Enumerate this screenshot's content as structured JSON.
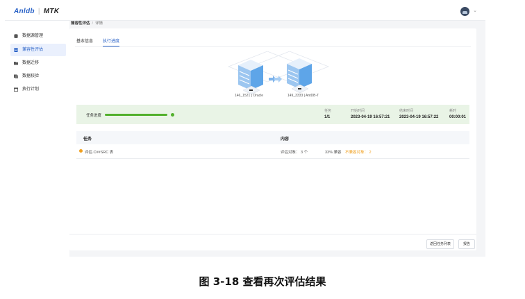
{
  "app": {
    "brand": "Anldb",
    "product": "MTK"
  },
  "sidebar": {
    "items": [
      {
        "label": "数据源管理",
        "icon": "database-icon",
        "active": false
      },
      {
        "label": "兼容性评估",
        "icon": "report-icon",
        "active": true
      },
      {
        "label": "数据迁移",
        "icon": "folder-icon",
        "active": false
      },
      {
        "label": "数据校验",
        "icon": "check-icon",
        "active": false
      },
      {
        "label": "执行计划",
        "icon": "calendar-icon",
        "active": false
      }
    ]
  },
  "breadcrumb": {
    "parent": "兼容性评估",
    "separator": "/",
    "current": "详情"
  },
  "tabs": [
    {
      "label": "基本信息",
      "active": false
    },
    {
      "label": "执行进度",
      "active": true
    }
  ],
  "diagram": {
    "source": {
      "label": "146_1521 | Oracle"
    },
    "target": {
      "label": "149_3333 | AntDB-T"
    }
  },
  "progress": {
    "label": "任务进度",
    "percent": 100,
    "stats": [
      {
        "key": "任务",
        "value": "1/1"
      },
      {
        "key": "开始时间",
        "value": "2023-04-19 16:57:21"
      },
      {
        "key": "结束时间",
        "value": "2023-04-19 16:57:22"
      },
      {
        "key": "耗时",
        "value": "00:00:01"
      }
    ]
  },
  "table": {
    "headers": [
      "任务",
      "内容"
    ],
    "rows": [
      {
        "task": "评估 C##SRC 表",
        "objects": "评估对象： 3 个",
        "compat": "33% 兼容",
        "incompat": "不兼容对象： 2"
      }
    ]
  },
  "buttons": {
    "back": "返回任务列表",
    "report": "报告"
  },
  "caption": "图 3-18  查看再次评估结果",
  "colors": {
    "accent": "#2b63c7",
    "success": "#52b02c",
    "warning": "#f0a020"
  }
}
